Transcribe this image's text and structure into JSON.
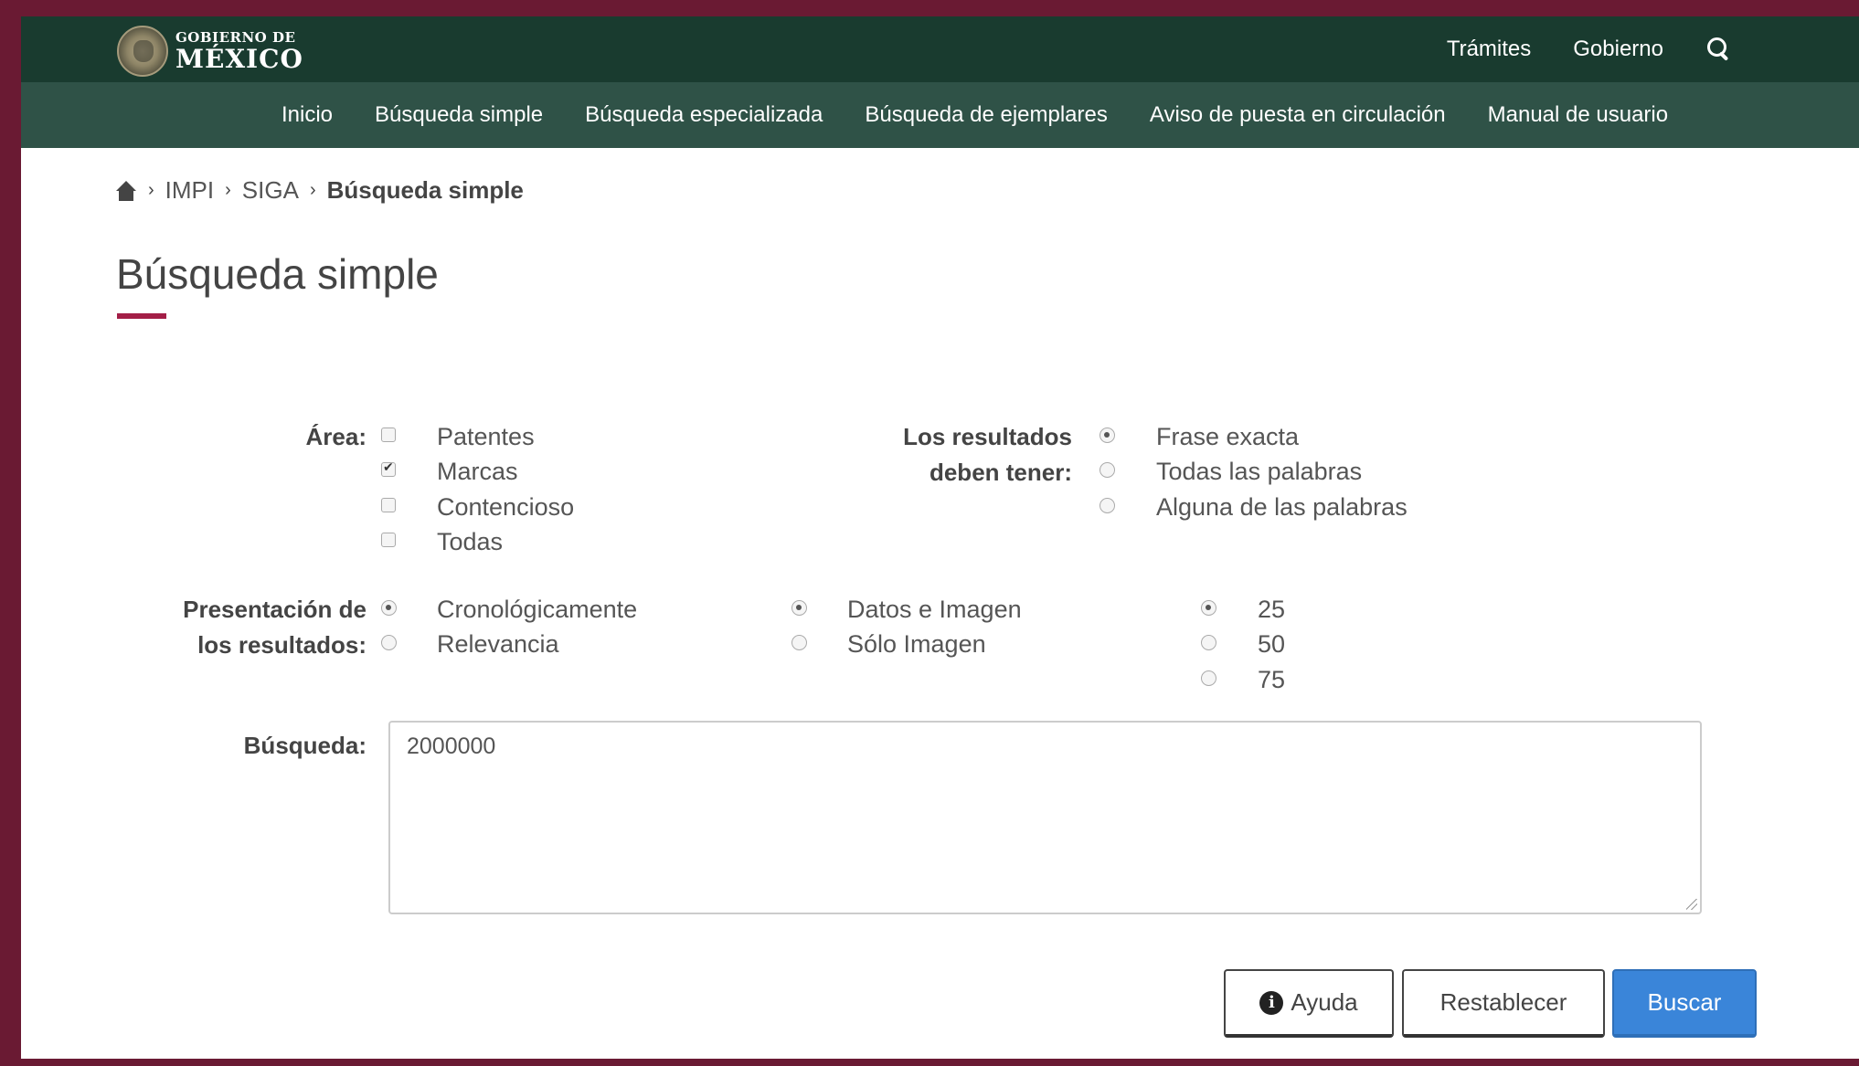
{
  "header": {
    "logo_line1": "GOBIERNO DE",
    "logo_line2": "MÉXICO",
    "links": [
      "Trámites",
      "Gobierno"
    ]
  },
  "subnav": {
    "items": [
      "Inicio",
      "Búsqueda simple",
      "Búsqueda especializada",
      "Búsqueda de ejemplares",
      "Aviso de puesta en circulación",
      "Manual de usuario"
    ]
  },
  "breadcrumb": {
    "items": [
      "IMPI",
      "SIGA"
    ],
    "current": "Búsqueda simple"
  },
  "page_title": "Búsqueda simple",
  "form": {
    "area": {
      "label": "Área:",
      "options": [
        {
          "label": "Patentes",
          "checked": false
        },
        {
          "label": "Marcas",
          "checked": true
        },
        {
          "label": "Contencioso",
          "checked": false
        },
        {
          "label": "Todas",
          "checked": false
        }
      ]
    },
    "results_must": {
      "label_line1": "Los resultados",
      "label_line2": "deben tener:",
      "options": [
        {
          "label": "Frase exacta",
          "checked": true
        },
        {
          "label": "Todas las palabras",
          "checked": false
        },
        {
          "label": "Alguna de las palabras",
          "checked": false
        }
      ]
    },
    "presentation": {
      "label_line1": "Presentación de",
      "label_line2": "los resultados:",
      "order": [
        {
          "label": "Cronológicamente",
          "checked": true
        },
        {
          "label": "Relevancia",
          "checked": false
        }
      ],
      "content": [
        {
          "label": "Datos e Imagen",
          "checked": true
        },
        {
          "label": "Sólo Imagen",
          "checked": false
        }
      ],
      "per_page": [
        {
          "label": "25",
          "checked": true
        },
        {
          "label": "50",
          "checked": false
        },
        {
          "label": "75",
          "checked": false
        }
      ]
    },
    "search": {
      "label": "Búsqueda:",
      "value": "2000000"
    }
  },
  "buttons": {
    "help": "Ayuda",
    "reset": "Restablecer",
    "search": "Buscar"
  },
  "colors": {
    "frame": "#6a1a33",
    "topbar": "#193b2f",
    "subnav": "#2f5247",
    "accent": "#a31e47",
    "primary_button": "#3a85d9"
  }
}
